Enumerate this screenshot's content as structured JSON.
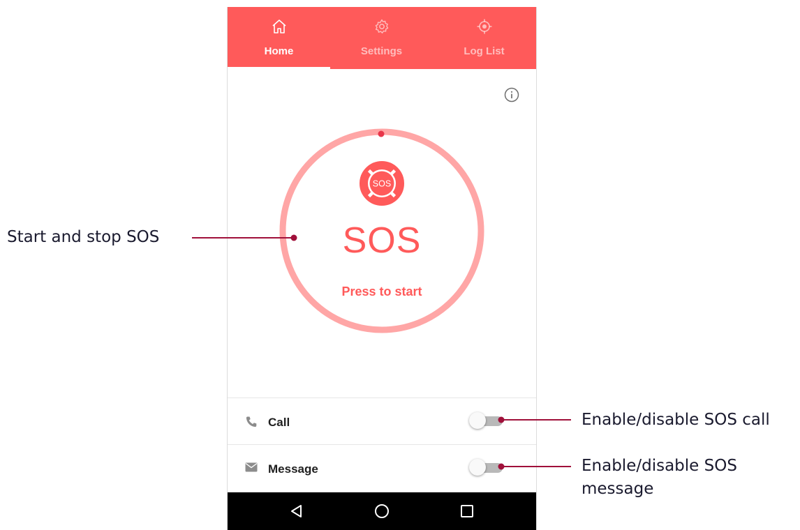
{
  "tabs": [
    {
      "label": "Home",
      "icon": "home-icon",
      "active": true
    },
    {
      "label": "Settings",
      "icon": "gear-icon",
      "active": false
    },
    {
      "label": "Log List",
      "icon": "location-target-icon",
      "active": false
    }
  ],
  "sos": {
    "badge_text": "SOS",
    "title": "SOS",
    "subtitle": "Press to start"
  },
  "settings_rows": [
    {
      "label": "Call",
      "icon": "phone-icon",
      "enabled": false
    },
    {
      "label": "Message",
      "icon": "envelope-icon",
      "enabled": false
    }
  ],
  "annotations": {
    "sos_button": "Start and stop SOS",
    "call_toggle": "Enable/disable SOS call",
    "message_toggle_line1": "Enable/disable SOS",
    "message_toggle_line2": "message"
  },
  "colors": {
    "accent": "#ff5a5a",
    "ring": "#ffa6a6",
    "annotation_line": "#a0103a",
    "nav_bar": "#000000"
  }
}
